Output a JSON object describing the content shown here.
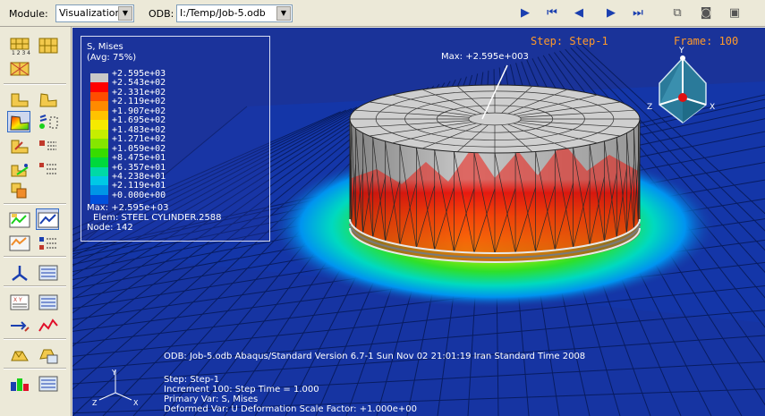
{
  "toolbar": {
    "module_label": "Module:",
    "module_value": "Visualization",
    "odb_label": "ODB:",
    "odb_value": "I:/Temp/Job-5.odb"
  },
  "legend": {
    "title": "S, Mises",
    "averaging": "(Avg: 75%)",
    "colors": [
      "#c8c8c8",
      "#ff0000",
      "#ff4d00",
      "#ff8a00",
      "#ffc300",
      "#f5ea00",
      "#c5ee00",
      "#85e600",
      "#37dc00",
      "#00d83c",
      "#00d9a6",
      "#00c8e6",
      "#0096e6",
      "#0050dc"
    ],
    "values": [
      "+2.595e+03",
      "+2.543e+02",
      "+2.331e+02",
      "+2.119e+02",
      "+1.907e+02",
      "+1.695e+02",
      "+1.483e+02",
      "+1.271e+02",
      "+1.059e+02",
      "+8.475e+01",
      "+6.357e+01",
      "+4.238e+01",
      "+2.119e+01",
      "+0.000e+00"
    ],
    "max_line": "Max: +2.595e+03",
    "elem_line": "Elem: STEEL CYLINDER.2588",
    "node_line": "Node: 142"
  },
  "viewport": {
    "step_label": "Step: Step-1",
    "frame_label": "Frame: 100",
    "max_annotation": "Max: +2.595e+003",
    "odb_info": "ODB: Job-5.odb    Abaqus/Standard Version 6.7-1    Sun Nov 02 21:01:19 Iran Standard Time 2008",
    "step_info": "Step: Step-1",
    "increment_info": "Increment    100: Step Time =     1.000",
    "primary_var": "Primary Var: S, Mises",
    "deformed_var": "Deformed Var: U   Deformation Scale Factor: +1.000e+00"
  },
  "triad": {
    "y": "Y",
    "z": "Z",
    "x": "X"
  }
}
